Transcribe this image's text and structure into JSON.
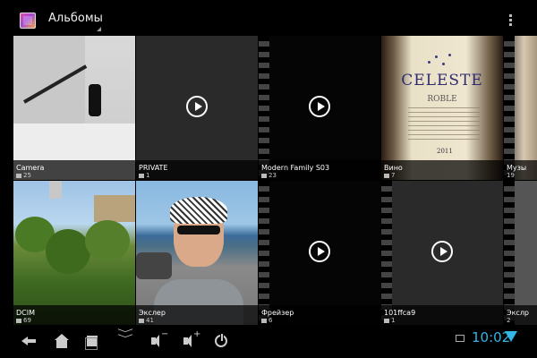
{
  "actionbar": {
    "title": "Альбомы"
  },
  "albums": [
    {
      "name": "Camera",
      "count": "25",
      "type": "photo"
    },
    {
      "name": "PRIVATE",
      "count": "1",
      "type": "video"
    },
    {
      "name": "Modern Family S03",
      "count": "23",
      "type": "video"
    },
    {
      "name": "Вино",
      "count": "7",
      "type": "photo"
    },
    {
      "name": "Музы",
      "count": "19",
      "type": "photo"
    },
    {
      "name": "DCIM",
      "count": "69",
      "type": "photo"
    },
    {
      "name": "Экслер",
      "count": "41",
      "type": "photo"
    },
    {
      "name": "Фрейзер",
      "count": "6",
      "type": "video"
    },
    {
      "name": "101ffca9",
      "count": "1",
      "type": "video"
    },
    {
      "name": "Экслр",
      "count": "2",
      "type": "photo"
    }
  ],
  "wine_label": {
    "brand": "CELESTE",
    "sub": "ROBLE",
    "year": "2011"
  },
  "statusbar": {
    "time": "10:02",
    "volume_down_sign": "−",
    "volume_up_sign": "+",
    "accent_color": "#33b5e5"
  },
  "icons": [
    "back-icon",
    "home-icon",
    "recent-apps-icon",
    "hide-bar-icon",
    "volume-down-icon",
    "volume-up-icon",
    "power-icon",
    "screenshot-icon",
    "wifi-icon",
    "overflow-menu-icon",
    "app-gallery-icon",
    "folder-icon",
    "play-icon"
  ]
}
